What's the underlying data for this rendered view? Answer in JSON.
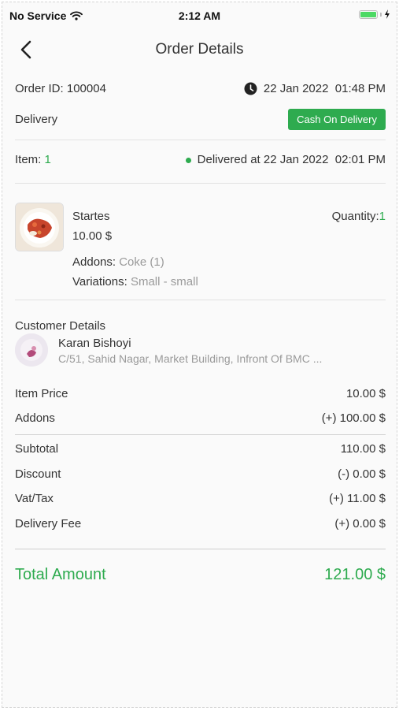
{
  "status": {
    "carrier": "No Service",
    "time": "2:12 AM"
  },
  "header": {
    "title": "Order Details"
  },
  "order": {
    "id_label": "Order ID:",
    "id": "100004",
    "date": "22 Jan 2022  01:48 PM",
    "type": "Delivery",
    "payment": "Cash On Delivery",
    "item_label": "Item:",
    "item_count": "1",
    "delivered": "Delivered at 22 Jan 2022  02:01 PM"
  },
  "product": {
    "name": "Startes",
    "price": "10.00 $",
    "quantity_label": "Quantity:",
    "quantity": "1",
    "addons_label": "Addons:",
    "addons": "Coke (1)",
    "variations_label": "Variations:",
    "variations": "Small - small"
  },
  "customer": {
    "section_title": "Customer Details",
    "name": "Karan Bishoyi",
    "address": "C/51, Sahid Nagar, Market Building, Infront Of BMC ..."
  },
  "summary": {
    "item_price_label": "Item Price",
    "item_price": "10.00 $",
    "addons_label": "Addons",
    "addons": "(+) 100.00 $",
    "subtotal_label": "Subtotal",
    "subtotal": "110.00 $",
    "discount_label": "Discount",
    "discount": "(-) 0.00 $",
    "vat_label": "Vat/Tax",
    "vat": "(+) 11.00 $",
    "delivery_label": "Delivery Fee",
    "delivery": "(+) 0.00 $",
    "total_label": "Total Amount",
    "total": "121.00 $"
  },
  "colors": {
    "accent": "#2eab4f",
    "muted": "#9a9a9a"
  },
  "icons": [
    "wifi-icon",
    "battery-icon",
    "charging-icon",
    "back-icon",
    "clock-icon",
    "status-dot-icon"
  ]
}
